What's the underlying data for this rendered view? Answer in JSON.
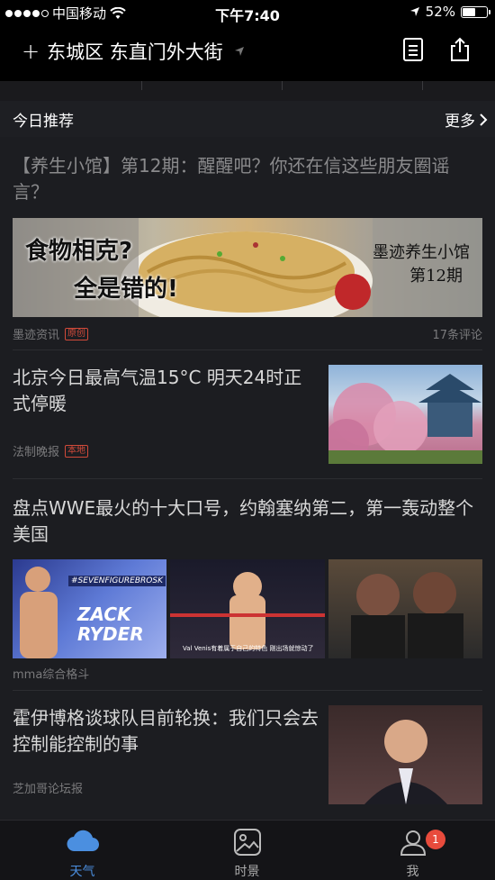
{
  "status_bar": {
    "carrier": "中国移动",
    "time": "下午7:40",
    "battery": "52%",
    "battery_level": 0.52
  },
  "header": {
    "location": "东城区 东直门外大街",
    "add_icon": "plus-icon",
    "location_icon": "location-arrow-icon",
    "list_icon": "document-list-icon",
    "share_icon": "share-icon"
  },
  "section": {
    "title": "今日推荐",
    "more_label": "更多"
  },
  "articles": [
    {
      "title": "【养生小馆】第12期：醒醒吧？你还在信这些朋友圈谣言？",
      "banner_text_left_1": "食物相克?",
      "banner_text_left_2": "全是错的!",
      "banner_text_right_1": "墨迹养生小馆",
      "banner_text_right_2": "第12期",
      "source": "墨迹资讯",
      "tag": "原创",
      "comments": "17条评论"
    },
    {
      "title": "北京今日最高气温15°C 明天24时正式停暖",
      "source": "法制晚报",
      "tag": "本地"
    },
    {
      "title": "盘点WWE最火的十大口号，约翰塞纳第二，第一轰动整个美国",
      "img1_text_1": "#SEVENFIGUREBROSK",
      "img1_text_2": "ZACK RYDER",
      "img2_caption": "Val Venis有着属于自己的特色 刚出场就惊动了",
      "source": "mma综合格斗"
    },
    {
      "title": "霍伊博格谈球队目前轮换：我们只会去控制能控制的事",
      "source": "芝加哥论坛报"
    }
  ],
  "tabbar": {
    "tabs": [
      {
        "label": "天气",
        "icon": "cloud-icon"
      },
      {
        "label": "时景",
        "icon": "photo-icon"
      },
      {
        "label": "我",
        "icon": "person-icon"
      }
    ],
    "badge": "1"
  },
  "colors": {
    "accent": "#4b8fe0",
    "badge": "#e84b3c",
    "tag": "#d14a3a",
    "background": "#1c1d21"
  }
}
